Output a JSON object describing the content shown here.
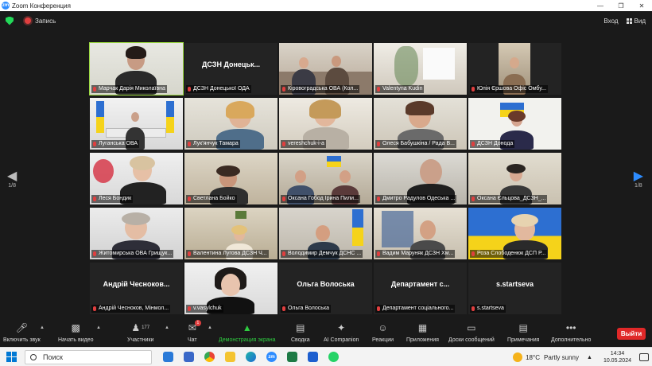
{
  "window": {
    "title": "Zoom Конференция",
    "logo": "zm"
  },
  "topbar": {
    "recording_label": "Запись",
    "exit_label": "Вход",
    "view_label": "Вид"
  },
  "pager": {
    "left": "1/8",
    "right": "1/8"
  },
  "tiles": [
    {
      "label": "Марчак Дарія Миколаївна",
      "big": ""
    },
    {
      "label": "ДСЗН Донецької ОДА",
      "big": "ДСЗН Донецьк..."
    },
    {
      "label": "Кіровоградська ОВА (Кол...",
      "big": ""
    },
    {
      "label": "Valentyna Kudin",
      "big": ""
    },
    {
      "label": "Юлія Єршова Офіс Омбу...",
      "big": ""
    },
    {
      "label": "Луганська ОВА",
      "big": ""
    },
    {
      "label": "Лук'янчук Тамара",
      "big": ""
    },
    {
      "label": "vereshchuk-i-a",
      "big": ""
    },
    {
      "label": "Олеся Бабушкіна / Рада В...",
      "big": ""
    },
    {
      "label": "ДСЗН Донода",
      "big": ""
    },
    {
      "label": "Леся Бондик",
      "big": ""
    },
    {
      "label": "Светлана Бойко",
      "big": ""
    },
    {
      "label": "Оксана Гобод Ірина Пили...",
      "big": ""
    },
    {
      "label": "Дмитро Радулов Одеська ...",
      "big": ""
    },
    {
      "label": "Оксана Єльцова_ДСЗН_...",
      "big": ""
    },
    {
      "label": "Житомирська ОВА Грищук...",
      "big": ""
    },
    {
      "label": "Валентина Лугова ДСЗН Ч...",
      "big": ""
    },
    {
      "label": "Володимир Демчук ДСНС ...",
      "big": ""
    },
    {
      "label": "Вадим Маруняк ДСЗН Хм...",
      "big": ""
    },
    {
      "label": "Роза Слободенюк ДСП Р...",
      "big": ""
    },
    {
      "label": "Андрій Чесноков, Мінмол...",
      "big": "Андрій Чесноков..."
    },
    {
      "label": "v.vasylchuk",
      "big": ""
    },
    {
      "label": "Ольга Волоська",
      "big": "Ольга Волоська"
    },
    {
      "label": "Департамент соціального...",
      "big": "Департамент с..."
    },
    {
      "label": "s.startseva",
      "big": "s.startseva"
    }
  ],
  "toolbar": {
    "audio": "Включить звук",
    "video": "Начать видео",
    "participants": "Участники",
    "participants_count": "177",
    "chat": "Чат",
    "chat_badge": "1",
    "share": "Демонстрация экрана",
    "summary": "Сводка",
    "ai": "AI Companion",
    "reactions": "Реакции",
    "apps": "Приложения",
    "whiteboards": "Доски сообщений",
    "notes": "Примечания",
    "more": "Дополнительно",
    "leave": "Выйти"
  },
  "taskbar": {
    "search_label": "Поиск",
    "weather_temp": "18°C",
    "weather_text": "Partly sunny",
    "time": "14:34",
    "date": "10.05.2024",
    "zoom_app": "zm"
  },
  "colors": {
    "accent": "#2d8cff",
    "active_speaker": "#9ad93e",
    "share_green": "#2ecc40",
    "leave_red": "#e02828"
  }
}
